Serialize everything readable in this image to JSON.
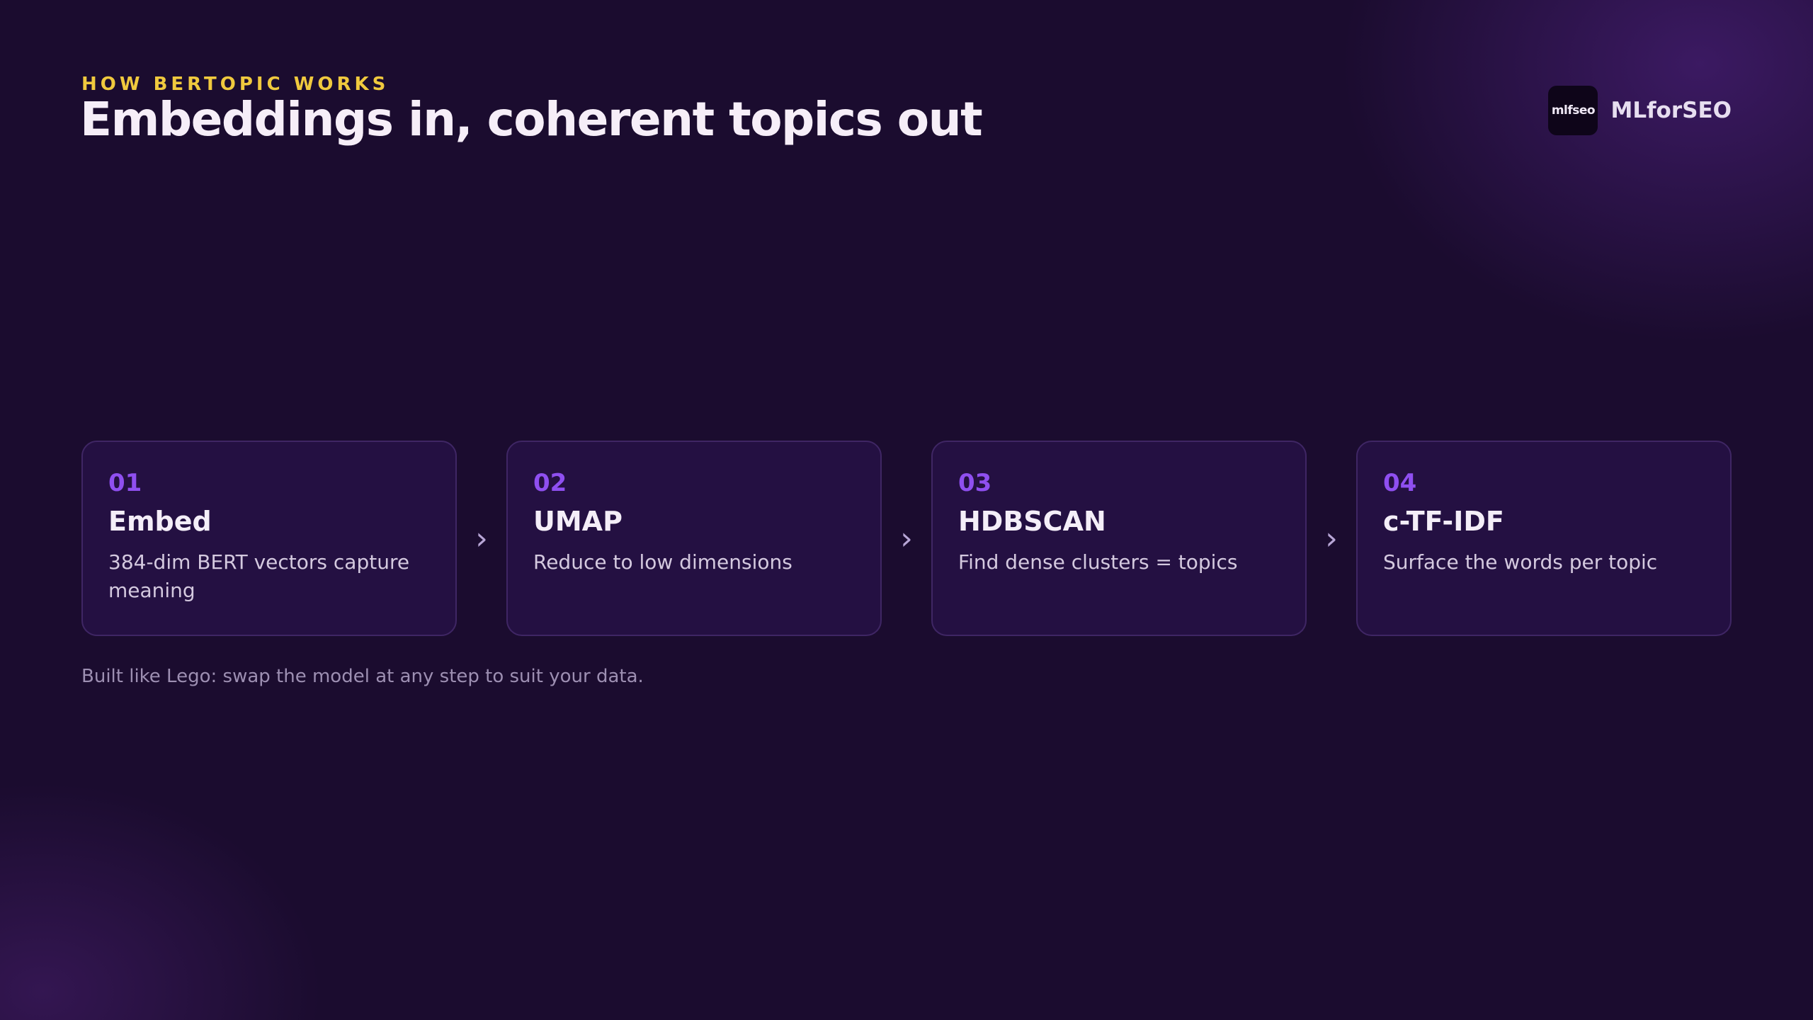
{
  "header": {
    "eyebrow": "HOW BERTOPIC WORKS",
    "title": "Embeddings in, coherent topics out"
  },
  "brand": {
    "logo_text": "mlfseo",
    "name": "MLforSEO"
  },
  "steps": [
    {
      "number": "01",
      "title": "Embed",
      "description": "384-dim BERT vectors capture meaning"
    },
    {
      "number": "02",
      "title": "UMAP",
      "description": "Reduce to low dimensions"
    },
    {
      "number": "03",
      "title": "HDBSCAN",
      "description": "Find dense clusters = topics"
    },
    {
      "number": "04",
      "title": "c-TF-IDF",
      "description": "Surface the words per topic"
    }
  ],
  "arrow_glyph": "›",
  "footnote": "Built like Lego: swap the model at any step to suit your data.",
  "colors": {
    "background": "#1b0c2f",
    "eyebrow": "#f0c93e",
    "step_number": "#8f4ff0",
    "card_border": "#3f2664",
    "card_fill": "#241042"
  }
}
